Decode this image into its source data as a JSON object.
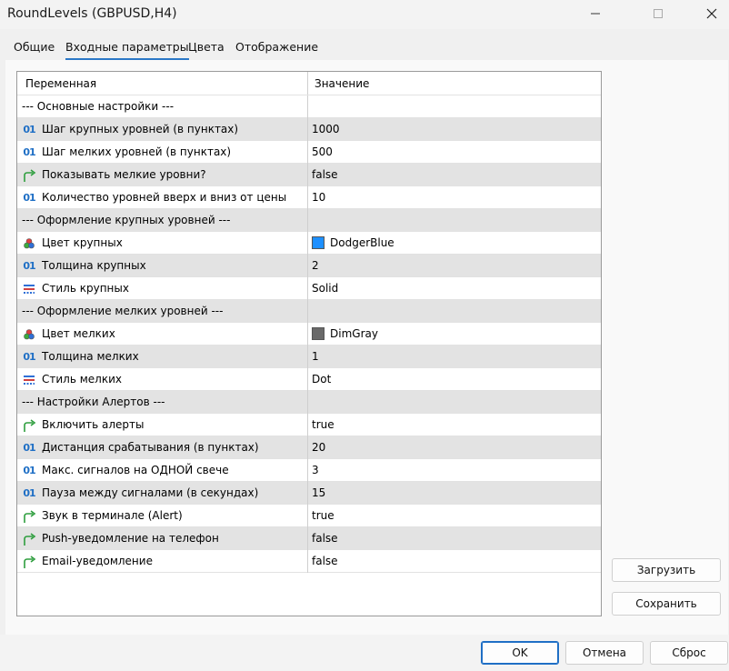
{
  "window": {
    "title": "RoundLevels (GBPUSD,H4)"
  },
  "tabs": [
    {
      "label": "Общие"
    },
    {
      "label": "Входные параметры"
    },
    {
      "label": "Цвета"
    },
    {
      "label": "Отображение"
    }
  ],
  "table": {
    "headers": {
      "variable": "Переменная",
      "value": "Значение"
    },
    "rows": [
      {
        "type": "section",
        "label": "--- Основные настройки ---",
        "value": ""
      },
      {
        "type": "int",
        "icon": "int-icon",
        "label": "Шаг крупных уровней (в пунктах)",
        "value": "1000"
      },
      {
        "type": "int",
        "icon": "int-icon",
        "label": "Шаг мелких уровней (в пунктах)",
        "value": "500"
      },
      {
        "type": "bool",
        "icon": "bool-arrow-icon",
        "label": "Показывать мелкие уровни?",
        "value": "false"
      },
      {
        "type": "int",
        "icon": "int-icon",
        "label": "Количество уровней вверх и вниз от цены",
        "value": "10"
      },
      {
        "type": "section",
        "label": "--- Оформление крупных уровней ---",
        "value": ""
      },
      {
        "type": "color",
        "icon": "color-palette-icon",
        "label": "Цвет крупных",
        "value": "DodgerBlue",
        "swatch": "#1e90ff"
      },
      {
        "type": "int",
        "icon": "int-icon",
        "label": "Толщина крупных",
        "value": "2"
      },
      {
        "type": "style",
        "icon": "line-style-icon",
        "label": "Стиль крупных",
        "value": "Solid"
      },
      {
        "type": "section",
        "label": "--- Оформление мелких уровней ---",
        "value": ""
      },
      {
        "type": "color",
        "icon": "color-palette-icon",
        "label": "Цвет мелких",
        "value": "DimGray",
        "swatch": "#696969"
      },
      {
        "type": "int",
        "icon": "int-icon",
        "label": "Толщина мелких",
        "value": "1"
      },
      {
        "type": "style",
        "icon": "line-style-icon",
        "label": "Стиль мелких",
        "value": "Dot"
      },
      {
        "type": "section",
        "label": "--- Настройки Алертов ---",
        "value": ""
      },
      {
        "type": "bool",
        "icon": "bool-arrow-icon",
        "label": "Включить алерты",
        "value": "true"
      },
      {
        "type": "int",
        "icon": "int-icon",
        "label": "Дистанция срабатывания (в пунктах)",
        "value": "20"
      },
      {
        "type": "int",
        "icon": "int-icon",
        "label": "Макс. сигналов на ОДНОЙ свече",
        "value": "3"
      },
      {
        "type": "int",
        "icon": "int-icon",
        "label": "Пауза между сигналами (в секундах)",
        "value": "15"
      },
      {
        "type": "bool",
        "icon": "bool-arrow-icon",
        "label": "Звук в терминале (Alert)",
        "value": "true"
      },
      {
        "type": "bool",
        "icon": "bool-arrow-icon",
        "label": "Push-уведомление на телефон",
        "value": "false"
      },
      {
        "type": "bool",
        "icon": "bool-arrow-icon",
        "label": "Email-уведомление",
        "value": "false"
      }
    ]
  },
  "side_buttons": {
    "load": "Загрузить",
    "save": "Сохранить"
  },
  "footer_buttons": {
    "ok": "OK",
    "cancel": "Отмена",
    "reset": "Сброс"
  },
  "colors": {
    "accent": "#2b78c7",
    "row_shade": "#e3e3e3",
    "int_icon": "#1f6fc5",
    "bool_icon": "#2e9e3e"
  }
}
